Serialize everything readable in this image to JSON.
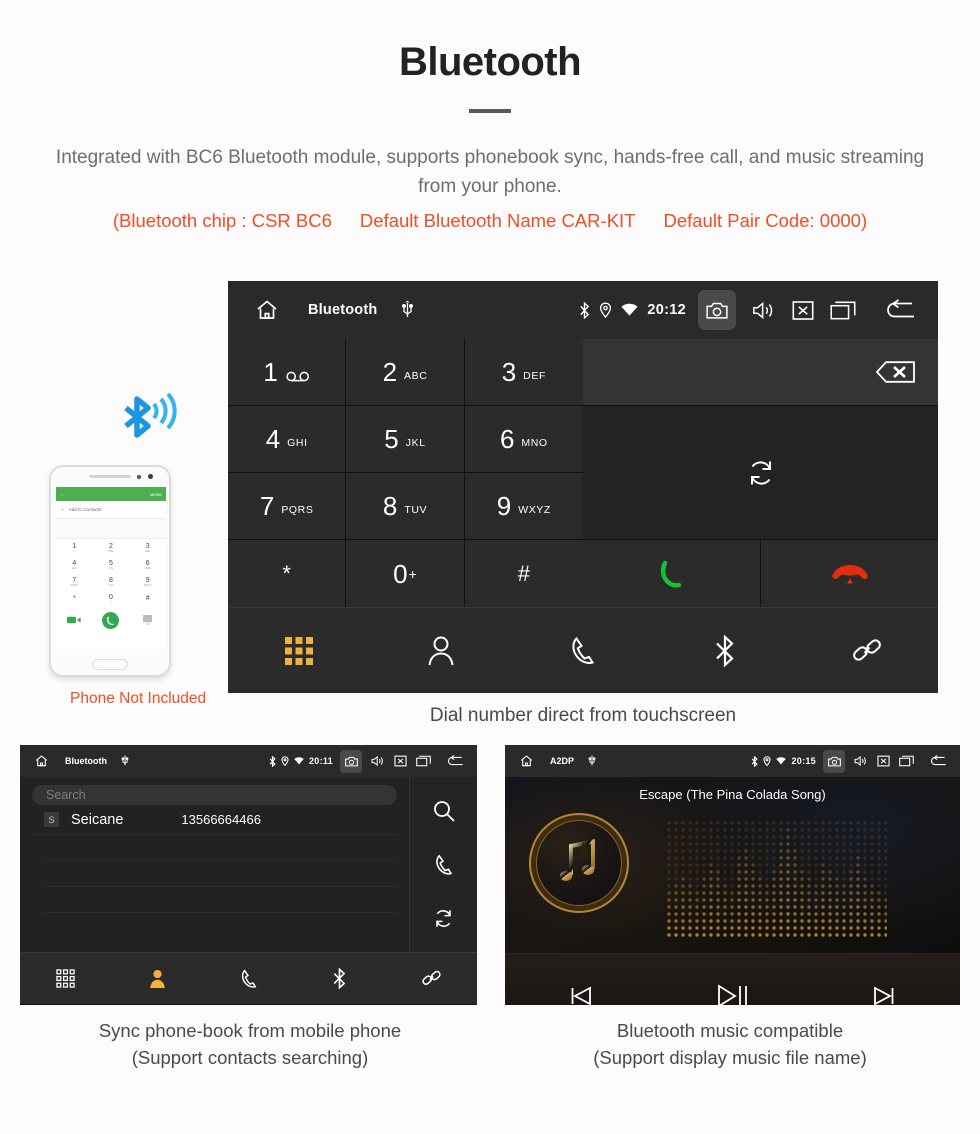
{
  "hero": {
    "title": "Bluetooth",
    "description": "Integrated with BC6 Bluetooth module, supports phonebook sync, hands-free call, and music streaming from your phone.",
    "note_chip": "(Bluetooth chip : CSR BC6",
    "note_name": "Default Bluetooth Name CAR-KIT",
    "note_pair": "Default Pair Code: 0000)",
    "accent_color": "#f04e23",
    "body_color": "#6e6e6e"
  },
  "dialer": {
    "topbar": {
      "title": "Bluetooth",
      "clock": "20:12",
      "icons": [
        "home-icon",
        "usb-icon",
        "bluetooth-icon",
        "location-icon",
        "wifi-icon",
        "camera-icon",
        "volume-icon",
        "close-box-icon",
        "recents-icon",
        "back-icon"
      ]
    },
    "keys": [
      {
        "num": "1",
        "sub": "",
        "glyph": "voicemail"
      },
      {
        "num": "2",
        "sub": "ABC",
        "glyph": ""
      },
      {
        "num": "3",
        "sub": "DEF",
        "glyph": ""
      },
      {
        "num": "4",
        "sub": "GHI",
        "glyph": ""
      },
      {
        "num": "5",
        "sub": "JKL",
        "glyph": ""
      },
      {
        "num": "6",
        "sub": "MNO",
        "glyph": ""
      },
      {
        "num": "7",
        "sub": "PQRS",
        "glyph": ""
      },
      {
        "num": "8",
        "sub": "TUV",
        "glyph": ""
      },
      {
        "num": "9",
        "sub": "WXYZ",
        "glyph": ""
      },
      {
        "num": "*",
        "sub": "",
        "glyph": ""
      },
      {
        "num": "0",
        "sub": "",
        "glyph": "plus"
      },
      {
        "num": "#",
        "sub": "",
        "glyph": ""
      }
    ],
    "actions": {
      "backspace": "backspace-icon",
      "sync": "sync-icon",
      "call": "call-icon",
      "hangup": "hangup-icon",
      "call_color": "#16c232",
      "hangup_color": "#e32d0f"
    },
    "nav": [
      {
        "name": "dialpad",
        "icon": "dialpad-icon",
        "active": true
      },
      {
        "name": "contacts",
        "icon": "contacts-icon",
        "active": false
      },
      {
        "name": "call-log",
        "icon": "phone-icon",
        "active": false
      },
      {
        "name": "bluetooth",
        "icon": "bluetooth-icon",
        "active": false
      },
      {
        "name": "pair-link",
        "icon": "link-icon",
        "active": false
      }
    ],
    "active_color": "#f0b23c"
  },
  "phone_mock": {
    "header_more": "MORE",
    "add_contacts": "Add to Contacts",
    "keys": [
      {
        "num": "1",
        "sub": "∞"
      },
      {
        "num": "2",
        "sub": "ABC"
      },
      {
        "num": "3",
        "sub": "DEF"
      },
      {
        "num": "4",
        "sub": "GHI"
      },
      {
        "num": "5",
        "sub": "JKL"
      },
      {
        "num": "6",
        "sub": "MNO"
      },
      {
        "num": "7",
        "sub": "PQRS"
      },
      {
        "num": "8",
        "sub": "TUV"
      },
      {
        "num": "9",
        "sub": "WXYZ"
      },
      {
        "num": "*",
        "sub": ""
      },
      {
        "num": "0",
        "sub": "+"
      },
      {
        "num": "#",
        "sub": ""
      }
    ],
    "disclaimer": "Phone Not Included"
  },
  "captions": {
    "main": "Dial number direct from touchscreen",
    "left_line1": "Sync phone-book from mobile phone",
    "left_line2": "(Support contacts searching)",
    "right_line1": "Bluetooth music compatible",
    "right_line2": "(Support display music file name)"
  },
  "phonebook": {
    "topbar": {
      "title": "Bluetooth",
      "clock": "20:11"
    },
    "search_placeholder": "Search",
    "contacts": [
      {
        "initial": "S",
        "name": "Seicane",
        "number": "13566664466"
      }
    ],
    "rail": [
      "search-icon",
      "phone-icon",
      "sync-icon"
    ],
    "nav": [
      {
        "name": "dialpad",
        "icon": "dialpad-icon",
        "active": false
      },
      {
        "name": "contacts",
        "icon": "contacts-icon",
        "active": true
      },
      {
        "name": "call-log",
        "icon": "phone-icon",
        "active": false
      },
      {
        "name": "bluetooth",
        "icon": "bluetooth-icon",
        "active": false
      },
      {
        "name": "pair-link",
        "icon": "link-icon",
        "active": false
      }
    ]
  },
  "music": {
    "topbar": {
      "title": "A2DP",
      "clock": "20:15"
    },
    "track_title": "Escape (The Pina Colada Song)",
    "controls": [
      {
        "name": "previous",
        "icon": "prev-icon"
      },
      {
        "name": "play-pause",
        "icon": "play-pause-icon"
      },
      {
        "name": "next",
        "icon": "next-icon"
      }
    ],
    "gold_color": "#c9952f"
  }
}
